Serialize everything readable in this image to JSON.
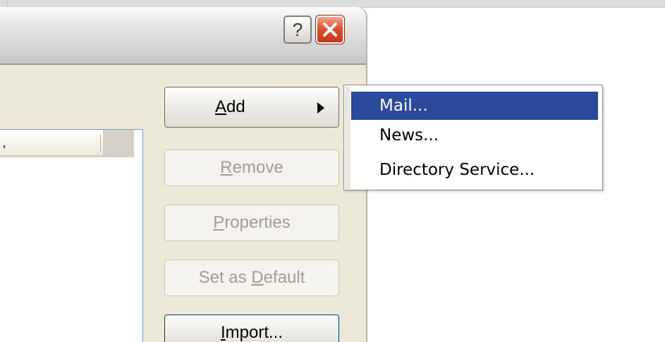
{
  "dialog": {
    "title_buttons": {
      "help_glyph": "?",
      "close_icon": "close-icon"
    }
  },
  "buttons": {
    "add": {
      "label": "Add",
      "mnemonic": "A"
    },
    "remove": {
      "label": "Remove",
      "mnemonic": "R",
      "enabled": false
    },
    "properties": {
      "label": "Properties",
      "mnemonic": "P",
      "enabled": false
    },
    "set_default": {
      "label": "Set as Default",
      "mnemonic": "D",
      "enabled": false
    },
    "import": {
      "label": "Import...",
      "mnemonic": "I"
    }
  },
  "add_menu": {
    "items": [
      {
        "label": "Mail...",
        "selected": true
      },
      {
        "label": "News...",
        "selected": false
      },
      {
        "label": "Directory Service...",
        "selected": false
      }
    ]
  },
  "colors": {
    "menu_highlight": "#2b4a9e",
    "dialog_bg": "#ece9d8",
    "close_button": "#d9472a",
    "disabled_text": "#a19f94"
  }
}
